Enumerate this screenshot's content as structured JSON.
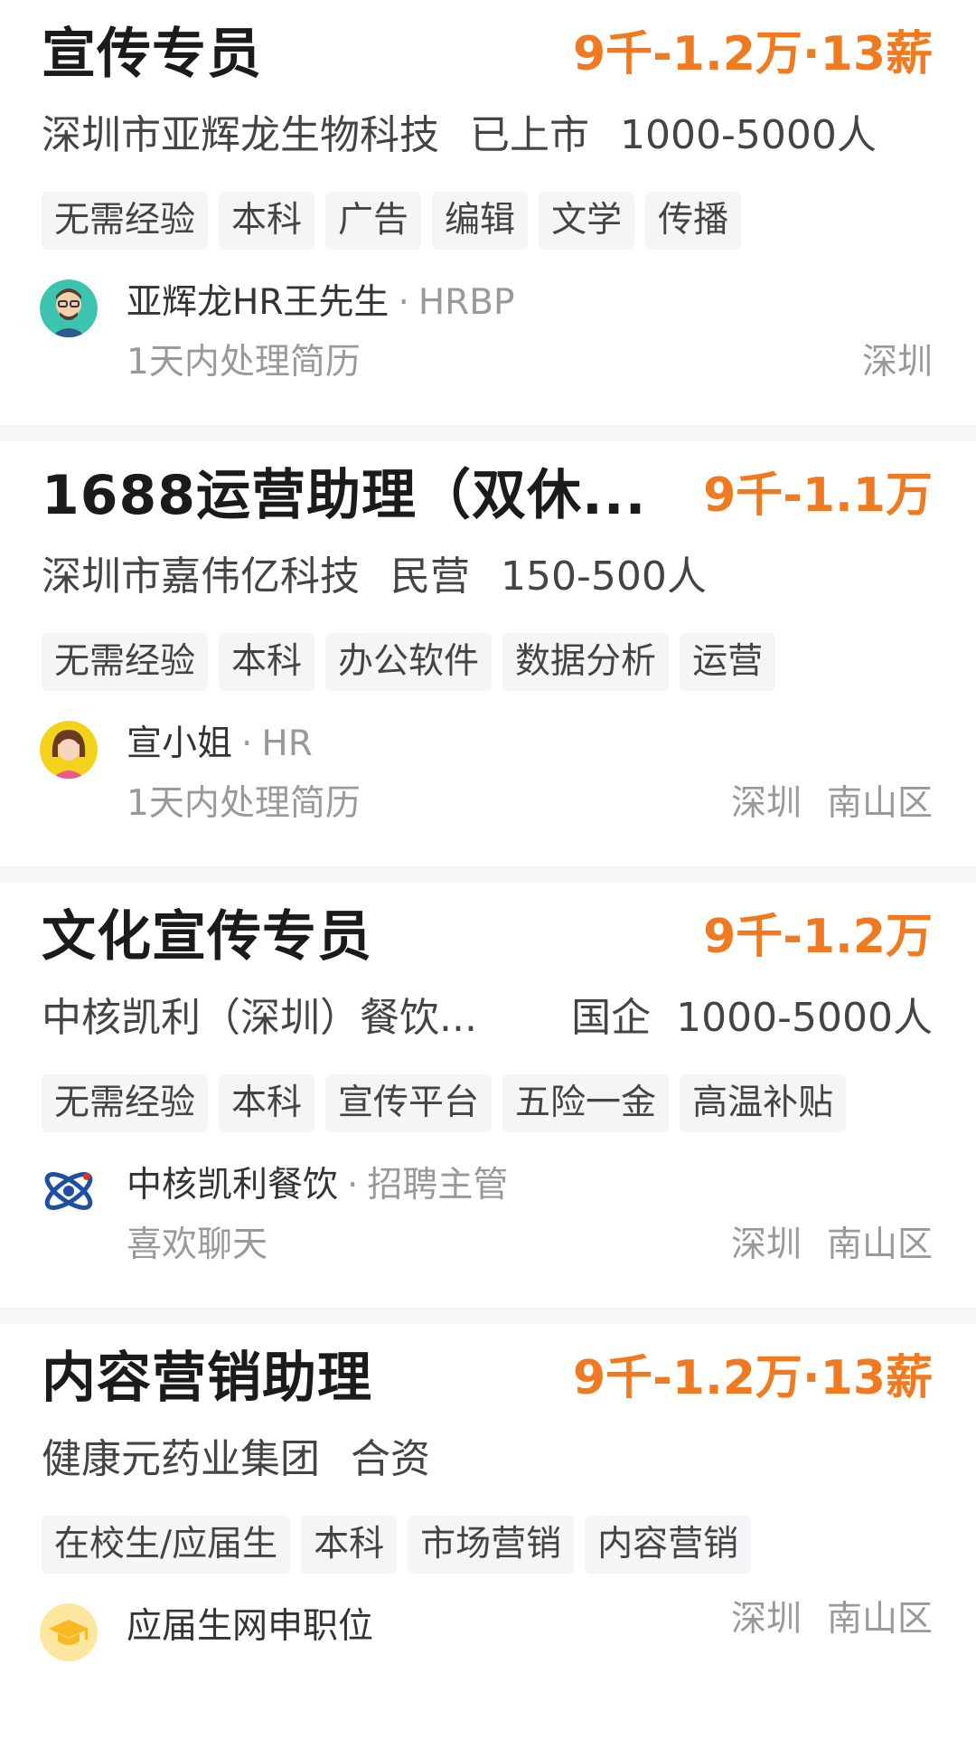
{
  "jobs": [
    {
      "title": "宣传专员",
      "salary": "9千-1.2万·13薪",
      "company": "深圳市亚辉龙生物科技",
      "stage": "已上市",
      "scale": "1000-5000人",
      "tags": [
        "无需经验",
        "本科",
        "广告",
        "编辑",
        "文学",
        "传播"
      ],
      "recruiter_name": "亚辉龙HR王先生",
      "recruiter_role": "HRBP",
      "status": "1天内处理简历",
      "city": "深圳",
      "district": "",
      "avatar_icon": "avatar-man-glasses-icon"
    },
    {
      "title": "1688运营助理（双休...",
      "salary": "9千-1.1万",
      "company": "深圳市嘉伟亿科技",
      "stage": "民营",
      "scale": "150-500人",
      "tags": [
        "无需经验",
        "本科",
        "办公软件",
        "数据分析",
        "运营"
      ],
      "recruiter_name": "宣小姐",
      "recruiter_role": "HR",
      "status": "1天内处理简历",
      "city": "深圳",
      "district": "南山区",
      "avatar_icon": "avatar-woman-icon"
    },
    {
      "title": "文化宣传专员",
      "salary": "9千-1.2万",
      "company": "中核凯利（深圳）餐饮...",
      "stage": "国企",
      "scale": "1000-5000人",
      "tags": [
        "无需经验",
        "本科",
        "宣传平台",
        "五险一金",
        "高温补贴"
      ],
      "recruiter_name": "中核凯利餐饮",
      "recruiter_role": "招聘主管",
      "status": "喜欢聊天",
      "city": "深圳",
      "district": "南山区",
      "avatar_icon": "atom-logo-icon"
    },
    {
      "title": "内容营销助理",
      "salary": "9千-1.2万·13薪",
      "company": "健康元药业集团",
      "stage": "合资",
      "scale": "",
      "tags": [
        "在校生/应届生",
        "本科",
        "市场营销",
        "内容营销"
      ],
      "recruiter_name": "应届生网申职位",
      "recruiter_role": "",
      "status": "",
      "city": "深圳",
      "district": "南山区",
      "avatar_icon": "graduation-cap-icon"
    }
  ],
  "colors": {
    "salary": "#f07a21",
    "title": "#1b1b1b",
    "muted": "#999999",
    "tag_bg": "#f4f5f7",
    "divider": "#f5f6f7"
  }
}
